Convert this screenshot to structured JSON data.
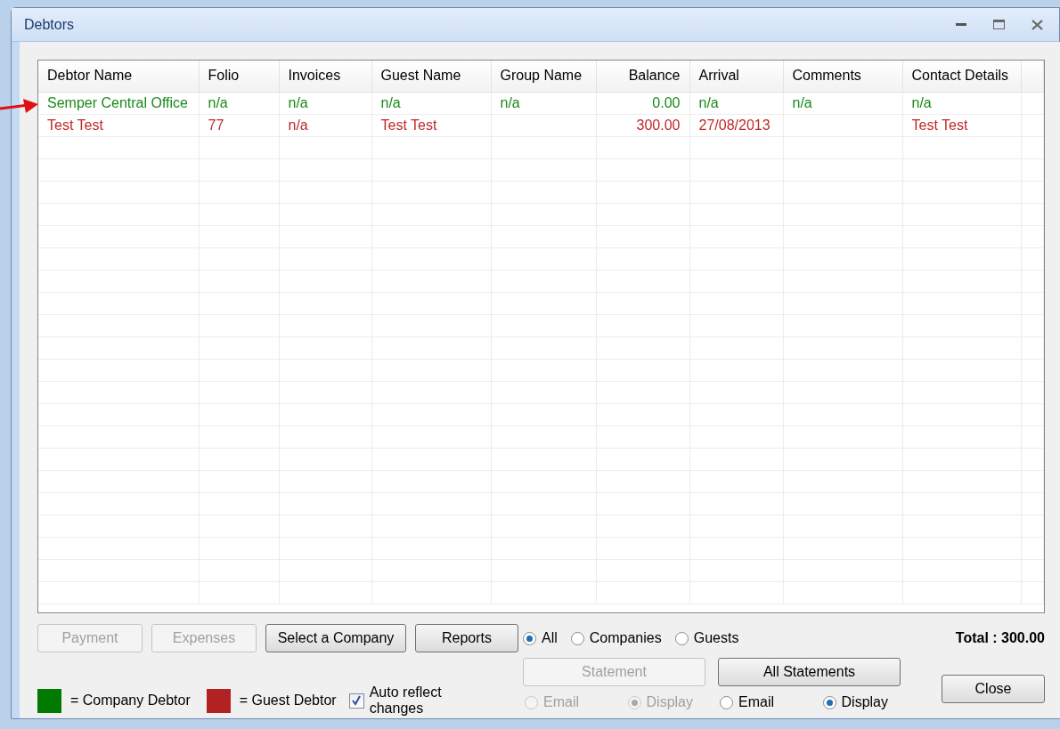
{
  "window": {
    "title": "Debtors"
  },
  "table": {
    "columns": [
      {
        "label": "Debtor Name",
        "kind": "text"
      },
      {
        "label": "Folio",
        "kind": "text"
      },
      {
        "label": "Invoices",
        "kind": "text"
      },
      {
        "label": "Guest Name",
        "kind": "text"
      },
      {
        "label": "Group Name",
        "kind": "text"
      },
      {
        "label": "Balance",
        "kind": "amount"
      },
      {
        "label": "Arrival",
        "kind": "text"
      },
      {
        "label": "Comments",
        "kind": "text"
      },
      {
        "label": "Contact Details",
        "kind": "text"
      }
    ],
    "rows": [
      {
        "color": "#1a8a1a",
        "cells": [
          "Semper Central Office",
          "n/a",
          "n/a",
          "n/a",
          "n/a",
          "0.00",
          "n/a",
          "n/a",
          "n/a"
        ]
      },
      {
        "color": "#c02828",
        "cells": [
          "Test Test",
          "77",
          "n/a",
          "Test Test",
          "",
          "300.00",
          "27/08/2013",
          "",
          "Test Test"
        ]
      }
    ]
  },
  "buttons": [
    {
      "label": "Payment",
      "disabled": true
    },
    {
      "label": "Expenses",
      "disabled": true
    },
    {
      "label": "Select a Company",
      "disabled": false
    },
    {
      "label": "Reports",
      "disabled": false
    }
  ],
  "filter": [
    {
      "label": "All",
      "selected": true
    },
    {
      "label": "Companies",
      "selected": false
    },
    {
      "label": "Guests",
      "selected": false
    }
  ],
  "total": "Total : 300.00",
  "legend": [
    {
      "color": "#007a00",
      "label": "= Company Debtor"
    },
    {
      "color": "#b22222",
      "label": "= Guest Debtor"
    }
  ],
  "auto_reflect": {
    "label": "Auto reflect changes",
    "checked": true
  },
  "statements": [
    {
      "button": "Statement",
      "disabled": true,
      "options": [
        {
          "label": "Email",
          "selected": false
        },
        {
          "label": "Display",
          "selected": true
        }
      ]
    },
    {
      "button": "All Statements",
      "disabled": false,
      "options": [
        {
          "label": "Email",
          "selected": false
        },
        {
          "label": "Display",
          "selected": true
        }
      ]
    }
  ],
  "close_button": "Close"
}
